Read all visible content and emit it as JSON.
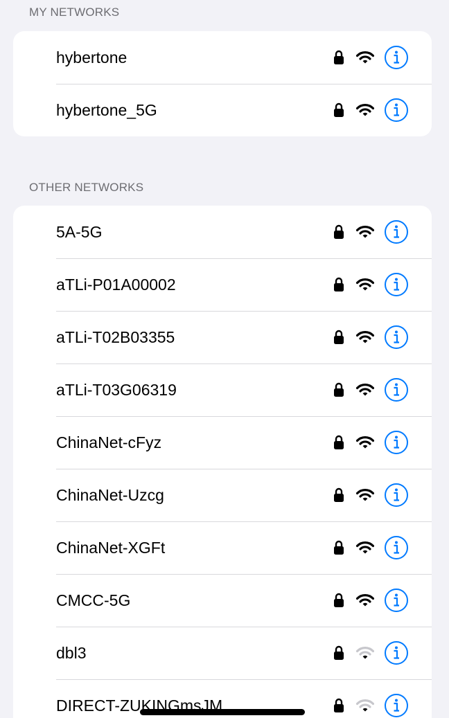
{
  "my_networks": {
    "header": "MY NETWORKS",
    "items": [
      {
        "name": "hybertone",
        "secured": true,
        "signal": "strong"
      },
      {
        "name": "hybertone_5G",
        "secured": true,
        "signal": "strong"
      }
    ]
  },
  "other_networks": {
    "header": "OTHER NETWORKS",
    "items": [
      {
        "name": "5A-5G",
        "secured": true,
        "signal": "strong"
      },
      {
        "name": "aTLi-P01A00002",
        "secured": true,
        "signal": "strong"
      },
      {
        "name": "aTLi-T02B03355",
        "secured": true,
        "signal": "strong"
      },
      {
        "name": "aTLi-T03G06319",
        "secured": true,
        "signal": "strong"
      },
      {
        "name": "ChinaNet-cFyz",
        "secured": true,
        "signal": "strong"
      },
      {
        "name": "ChinaNet-Uzcg",
        "secured": true,
        "signal": "strong"
      },
      {
        "name": "ChinaNet-XGFt",
        "secured": true,
        "signal": "strong"
      },
      {
        "name": "CMCC-5G",
        "secured": true,
        "signal": "strong"
      },
      {
        "name": "dbl3",
        "secured": true,
        "signal": "weak"
      },
      {
        "name": "DIRECT-ZUKINGmsJM",
        "secured": true,
        "signal": "weak"
      }
    ]
  },
  "icons": {
    "lock": "lock-icon",
    "wifi": "wifi-icon",
    "info": "info-icon"
  },
  "colors": {
    "accent": "#007aff",
    "wifi_strong": "#000000",
    "wifi_weak": "#c7c7cc"
  }
}
